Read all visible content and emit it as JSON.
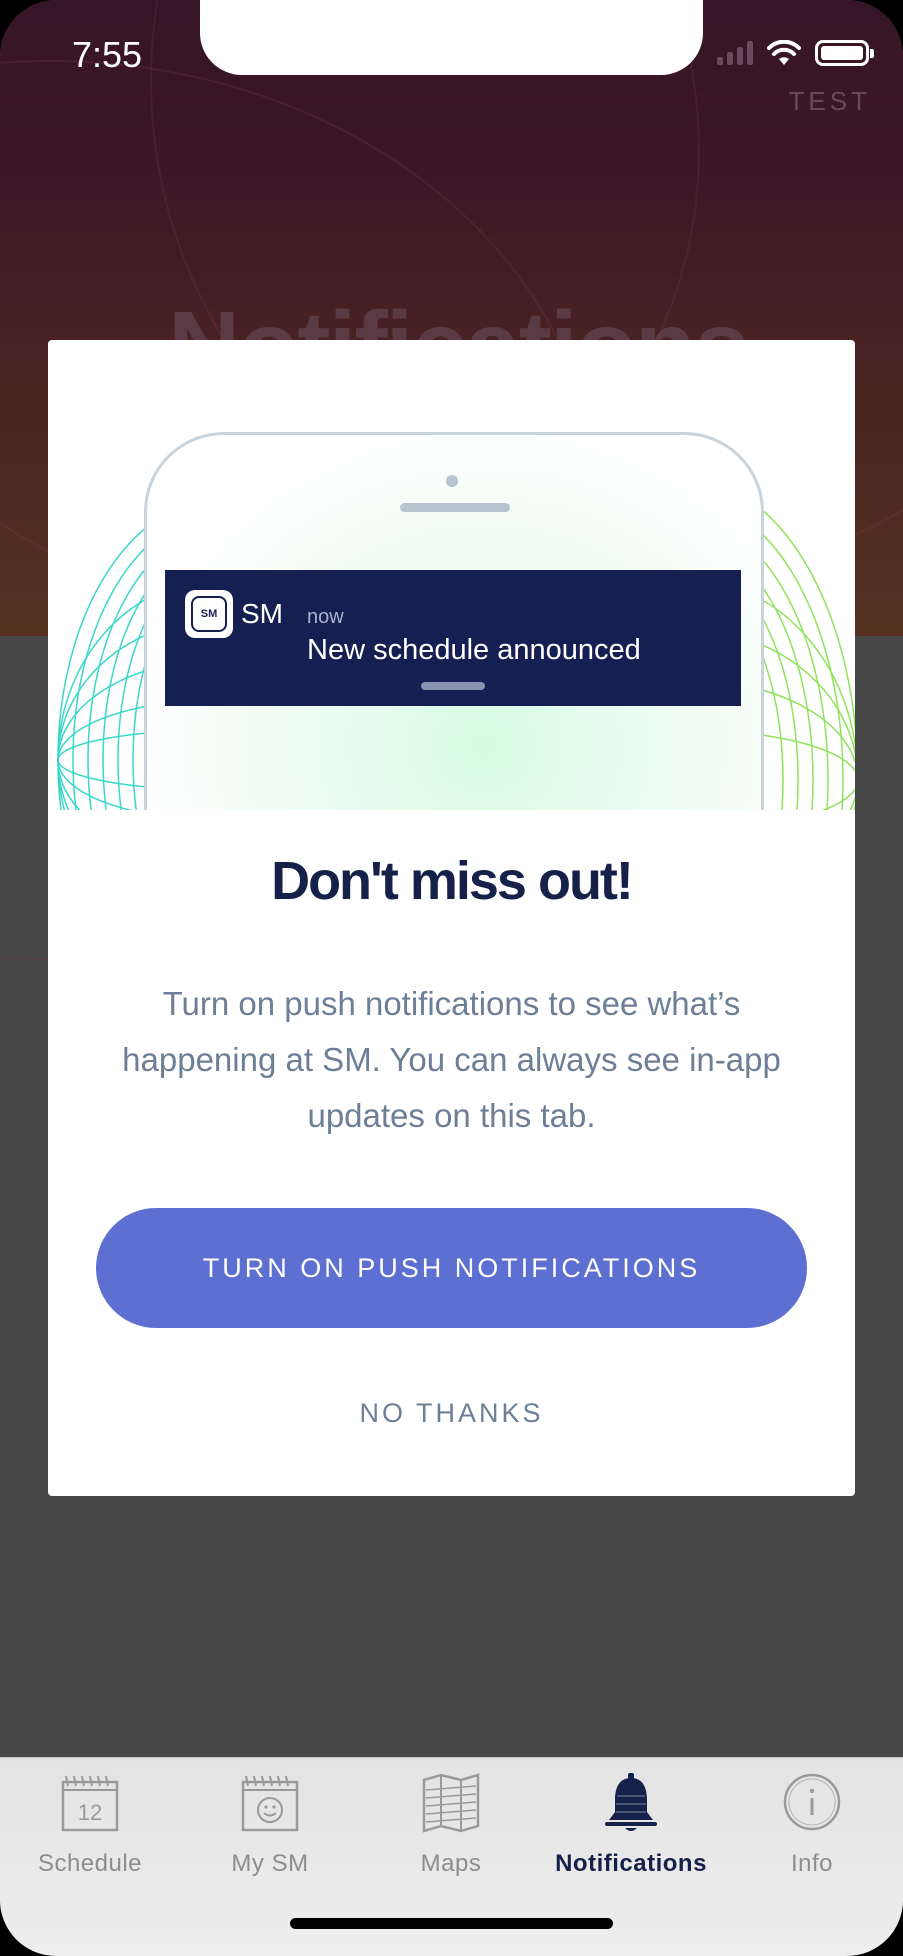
{
  "status_bar": {
    "time": "7:55"
  },
  "header": {
    "title": "Notifications",
    "env_label": "TEST"
  },
  "modal": {
    "notification_preview": {
      "app_icon_text": "SM",
      "app_name": "SM",
      "time": "now",
      "message": "New schedule announced"
    },
    "heading": "Don't miss out!",
    "body": "Turn on push notifications to see what’s happening at SM. You can always see in-app updates on this tab.",
    "primary_button": "TURN ON PUSH NOTIFICATIONS",
    "secondary_button": "NO THANKS"
  },
  "tabbar": {
    "items": [
      {
        "label": "Schedule",
        "icon": "calendar-icon",
        "calendar_day": "12",
        "active": false
      },
      {
        "label": "My SM",
        "icon": "calendar-smiley-icon",
        "active": false
      },
      {
        "label": "Maps",
        "icon": "map-icon",
        "active": false
      },
      {
        "label": "Notifications",
        "icon": "bell-icon",
        "active": true
      },
      {
        "label": "Info",
        "icon": "info-icon",
        "active": false
      }
    ]
  },
  "colors": {
    "primary_button": "#5d6fd1",
    "heading": "#16214a",
    "body_text": "#6d7f96",
    "notification_banner": "#161f52",
    "active_tab": "#16214a",
    "inactive_tab": "#8d8d8d"
  }
}
